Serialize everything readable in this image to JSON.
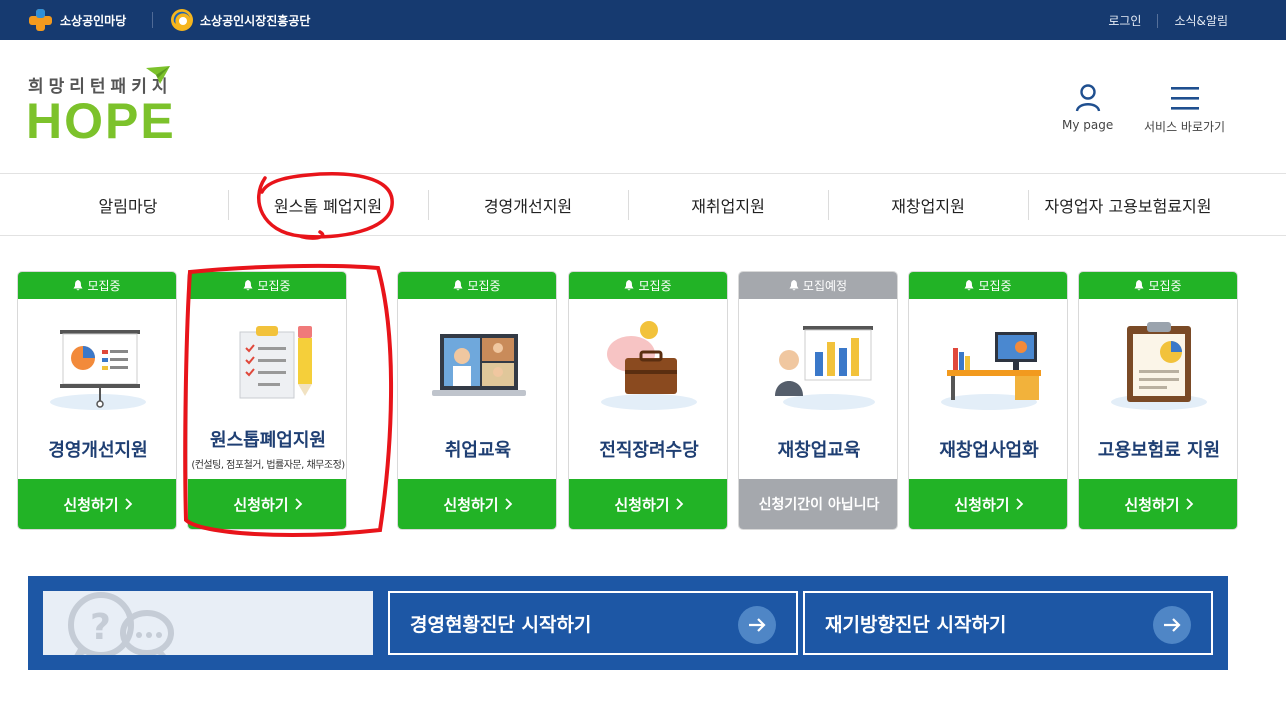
{
  "topbar": {
    "logo1": "소상공인마당",
    "logo2": "소상공인시장진흥공단",
    "links": [
      "로그인",
      "소식&알림"
    ]
  },
  "header": {
    "brand_sub": "희망리턴패키지",
    "brand_main": "HOPE",
    "mypage_label": "My page",
    "service_label": "서비스 바로가기"
  },
  "nav": {
    "items": [
      "알림마당",
      "원스톱 폐업지원",
      "경영개선지원",
      "재취업지원",
      "재창업지원",
      "자영업자 고용보험료지원"
    ]
  },
  "cards": [
    {
      "status": "모집중",
      "title": "경영개선지원",
      "subtitle": "",
      "apply": "신청하기",
      "icon": "presentation-board-icon"
    },
    {
      "status": "모집중",
      "title": "원스톱폐업지원",
      "subtitle": "(컨설팅, 점포철거, 법률자문, 채무조정)",
      "apply": "신청하기",
      "icon": "clipboard-checklist-icon"
    },
    {
      "status": "모집중",
      "title": "취업교육",
      "subtitle": "",
      "apply": "신청하기",
      "icon": "video-call-laptop-icon"
    },
    {
      "status": "모집중",
      "title": "전직장려수당",
      "subtitle": "",
      "apply": "신청하기",
      "icon": "piggy-bank-briefcase-icon"
    },
    {
      "status": "모집예정",
      "title": "재창업교육",
      "subtitle": "",
      "apply": "신청기간이 아닙니다",
      "icon": "presenter-chart-icon"
    },
    {
      "status": "모집중",
      "title": "재창업사업화",
      "subtitle": "",
      "apply": "신청하기",
      "icon": "office-desk-icon"
    },
    {
      "status": "모집중",
      "title": "고용보험료 지원",
      "subtitle": "",
      "apply": "신청하기",
      "icon": "clipboard-pie-chart-icon"
    }
  ],
  "banner": {
    "btn1": "경영현황진단 시작하기",
    "btn2": "재기방향진단 시작하기"
  },
  "colors": {
    "topbar": "#163a70",
    "green": "#22b326",
    "gray": "#a5a8ad",
    "navy_title": "#1f3f73",
    "banner": "#1d57a5",
    "brand_green": "#7cc22b",
    "annotation_red": "#e8141a"
  }
}
